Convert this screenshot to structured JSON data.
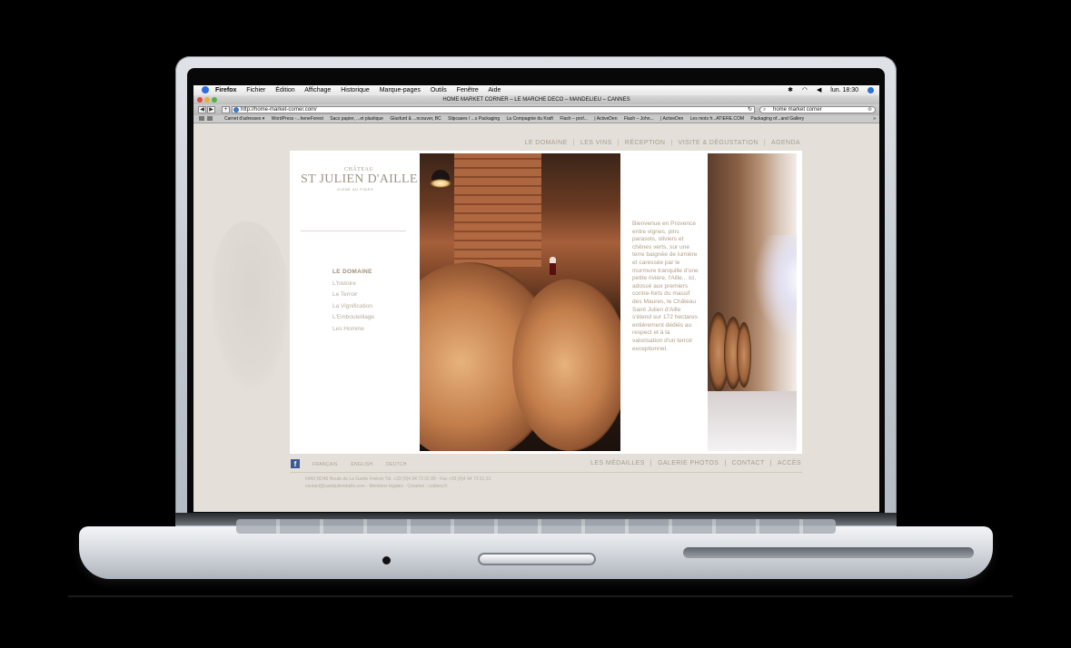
{
  "browser": {
    "app_menu": [
      "Firefox",
      "Fichier",
      "Édition",
      "Affichage",
      "Historique",
      "Marque-pages",
      "Outils",
      "Fenêtre",
      "Aide"
    ],
    "clock": "lun. 18:30",
    "window_title": "HOME MARKET CORNER – LE MARCHE DECO – MANDELIEU – CANNES",
    "url": "http://home-market-corner.com/",
    "search_value": "home market corner",
    "bookmarks": [
      "Carnet d'adresses ▾",
      "WordPress -...heneForest",
      "Sacs papier, ...et plastique",
      "Glasfurd & ...ncouver, BC",
      "Slipcases / ...s Packaging",
      "La Compagnie du Kraft",
      "Flash – prof...",
      "| ActiveDen",
      "Flash – John...",
      "| ActiveDen",
      "Les mots fr...ATIERE.COM",
      "Packaging of...and Gallery"
    ],
    "bookmarks_more": "»"
  },
  "site": {
    "top_nav": [
      "LE DOMAINE",
      "LES VINS",
      "RÉCEPTION",
      "VISITE & DÉGUSTATION",
      "AGENDA"
    ],
    "logo_top": "CHÂTEAU",
    "logo_main": "ST JULIEN D'AILLE",
    "logo_sub": "VIGNE AU FIDES",
    "side_nav": {
      "active": "LE DOMAINE",
      "items": [
        "L'histoire",
        "Le Terroir",
        "La Vignification",
        "L'Embouteillage",
        "Les Homme"
      ]
    },
    "intro_text": "Bienvenue en Provence entre vignes, pins parasols, oliviers et chênes verts, sur une terre baignée de lumière et caressée par le murmure tranquille d'une petite rivière, l'Aille... ici, adossé aux premiers contre-forts du massif des Maures, le Château Saint Julien d'Aille s'étend sur 172 hectares entièrement dédiés au respect et à la valorisation d'un terroir exceptionnel.",
    "languages": [
      "FRANÇAIS",
      "ENGLISH",
      "DEUTCH"
    ],
    "bottom_nav": [
      "LES MÉDAILLES",
      "GALERIE PHOTOS",
      "CONTACT",
      "ACCÈS"
    ],
    "footer_line1": "5460 RD46 Route de La Garde Freinet Tél. +33 (0)4 94 73 02 89 - Fax +33 (0)4 94 73 61 31",
    "footer_line2": "contact@saintjuliendaille.com - Mentions légales - Création : caldera.fr"
  }
}
